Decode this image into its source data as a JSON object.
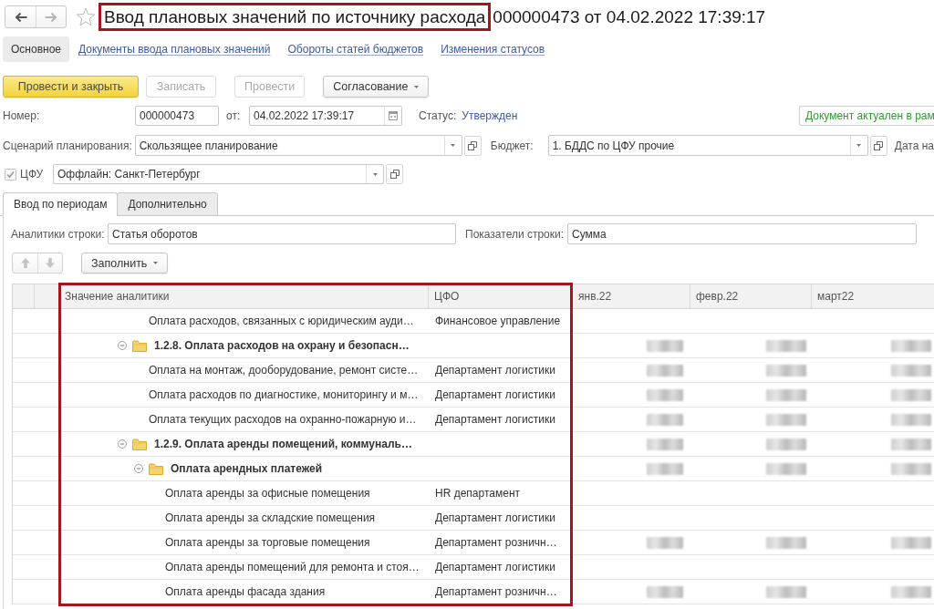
{
  "header": {
    "nav": {
      "back": {
        "disabled": false
      },
      "forward": {
        "disabled": true
      }
    },
    "favorite": false,
    "title": {
      "text": "Ввод плановых значений по источнику расхода",
      "highlighted": true
    },
    "subtitle": "000000473 от 04.02.2022 17:39:17"
  },
  "sections": [
    {
      "label": "Основное",
      "selected": true
    },
    {
      "label": "Документы ввода плановых значений",
      "selected": false
    },
    {
      "label": "Обороты статей бюджетов",
      "selected": false
    },
    {
      "label": "Изменения статусов",
      "selected": false
    }
  ],
  "command_bar": {
    "buttons": [
      {
        "label": "Провести и закрыть",
        "kind": "primary",
        "disabled": false
      },
      {
        "label": "Записать",
        "kind": "plain",
        "disabled": true
      },
      {
        "label": "Провести",
        "kind": "plain",
        "disabled": true
      },
      {
        "label": "Согласование",
        "kind": "menu",
        "disabled": false
      }
    ]
  },
  "fields": {
    "number": {
      "label": "Номер:",
      "value": "000000473"
    },
    "date": {
      "label": "от:",
      "value": "04.02.2022 17:39:17"
    },
    "status": {
      "label": "Статус:",
      "value": "Утвержден"
    },
    "relevance_message": "Документ актуален в рам",
    "scenario": {
      "label": "Сценарий планирования:",
      "value": "Скользящее планирование"
    },
    "budget": {
      "label": "Бюджет:",
      "value": "1. БДДС по ЦФУ прочие"
    },
    "next_field_label": "Дата на",
    "cfu": {
      "label": "ЦФУ",
      "checked": true,
      "value": "Оффлайн: Санкт-Петербург"
    }
  },
  "tabs": [
    {
      "label": "Ввод по периодам",
      "selected": true
    },
    {
      "label": "Дополнительно",
      "selected": false
    }
  ],
  "row_settings": {
    "analytics": {
      "label": "Аналитики строки:",
      "value": "Статья оборотов"
    },
    "indicators": {
      "label": "Показатели строки:",
      "value": "Сумма"
    }
  },
  "table_toolbar": {
    "move_up": {
      "disabled": true
    },
    "move_down": {
      "disabled": true
    },
    "fill_button": "Заполнить"
  },
  "table": {
    "columns": [
      {
        "label": "Значение аналитики",
        "highlighted": true
      },
      {
        "label": "ЦФО",
        "highlighted": true
      },
      {
        "label": "янв.22",
        "highlighted": false
      },
      {
        "label": "февр.22",
        "highlighted": false
      },
      {
        "label": "март22",
        "highlighted": false
      }
    ],
    "rows": [
      {
        "kind": "hidden_group",
        "children": [
          {
            "kind": "leaf",
            "analytic": "Оплата расходов, связанных с юридическим ауди…",
            "cfo": "Финансовое управление",
            "values_blurred": false
          }
        ]
      },
      {
        "kind": "group",
        "analytic": "1.2.8. Оплата расходов на охрану и безопасн…",
        "expanded": true,
        "values_blurred": true,
        "children": [
          {
            "kind": "leaf",
            "analytic": "Оплата на монтаж, дооборудование, ремонт систе…",
            "cfo": "Департамент логистики",
            "values_blurred": true
          },
          {
            "kind": "leaf",
            "analytic": "Оплата расходов по диагностике, мониторингу и м…",
            "cfo": "Департамент логистики",
            "values_blurred": true
          },
          {
            "kind": "leaf",
            "analytic": "Оплата текущих расходов на охранно-пожарную и…",
            "cfo": "Департамент логистики",
            "values_blurred": true
          }
        ]
      },
      {
        "kind": "group",
        "analytic": "1.2.9. Оплата аренды помещений, коммуналь…",
        "expanded": true,
        "values_blurred": true,
        "children": [
          {
            "kind": "group",
            "analytic": "Оплата арендных платежей",
            "expanded": true,
            "values_blurred": true,
            "children": [
              {
                "kind": "leaf",
                "analytic": "Оплата аренды за офисные помещения",
                "cfo": "HR департамент",
                "values_blurred": false
              },
              {
                "kind": "leaf",
                "analytic": "Оплата аренды за складские помещения",
                "cfo": "Департамент логистики",
                "values_blurred": false
              },
              {
                "kind": "leaf",
                "analytic": "Оплата аренды за торговые помещения",
                "cfo": "Департамент розничн…",
                "values_blurred": true
              },
              {
                "kind": "leaf",
                "analytic": "Оплата аренды помещений для ремонта и стоя…",
                "cfo": "Департамент логистики",
                "values_blurred": false
              },
              {
                "kind": "leaf",
                "analytic": "Оплата аренды фасада здания",
                "cfo": "Департамент розничн…",
                "values_blurred": true
              }
            ]
          }
        ]
      }
    ]
  }
}
